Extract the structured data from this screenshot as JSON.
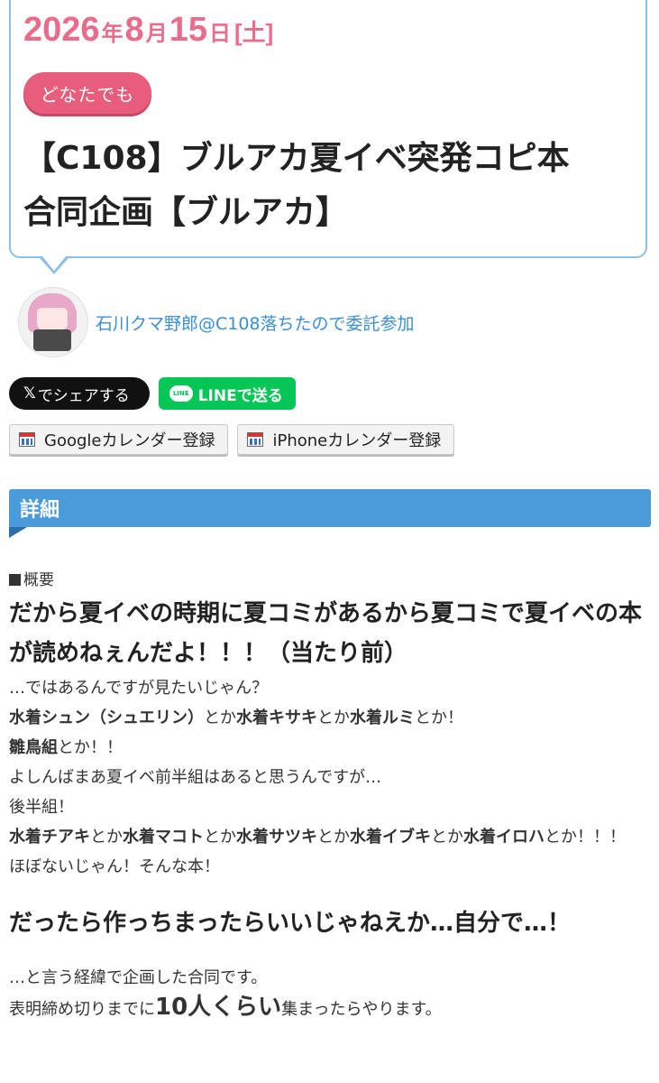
{
  "event": {
    "year": "2026",
    "year_unit": "年",
    "month": "8",
    "month_unit": "月",
    "day": "15",
    "day_unit": "日",
    "weekday": "[土]",
    "audience_badge": "どなたでも",
    "title": "【C108】ブルアカ夏イベ突発コピ本合同企画【ブルアカ】",
    "author": "石川クマ野郎@C108落ちたので委託参加"
  },
  "share": {
    "x_glyph": "𝕏",
    "x_label": "でシェアする",
    "line_logo": "LINE",
    "line_label": "LINEで送る"
  },
  "calendar": {
    "google_label": "Googleカレンダー登録",
    "iphone_label": "iPhoneカレンダー登録"
  },
  "details": {
    "section_title": "詳細",
    "overview_label": "概要",
    "lead": "だから夏イベの時期に夏コミがあるから夏コミで夏イベの本が読めねぇんだよ！！！（当たり前）",
    "line1": "…ではあるんですが見たいじゃん？",
    "line2_b1": "水着シュン（シュエリン）",
    "line2_t1": "とか",
    "line2_b2": "水着キサキ",
    "line2_t2": "とか",
    "line2_b3": "水着ルミ",
    "line2_t3": "とか！",
    "line3_b1": "雛鳥組",
    "line3_t1": "とか！！",
    "line4": "よしんばまあ夏イベ前半組はあると思うんですが…",
    "line5": "後半組！",
    "line6_b1": "水着チアキ",
    "line6_t1": "とか",
    "line6_b2": "水着マコト",
    "line6_t2": "とか",
    "line6_b3": "水着サツキ",
    "line6_t3": "とか",
    "line6_b4": "水着イブキ",
    "line6_t4": "とか",
    "line6_b5": "水着イロハ",
    "line6_t5": "とか！！！",
    "line7": "ほぼないじゃん！そんな本！",
    "lead2": "だったら作っちまったらいいじゃねえか…自分で…！",
    "line8": "…と言う経緯で企画した合同です。",
    "line9_t1": "表明締め切りまでに",
    "line9_big": "10人くらい",
    "line9_t2": "集まったらやります。"
  }
}
